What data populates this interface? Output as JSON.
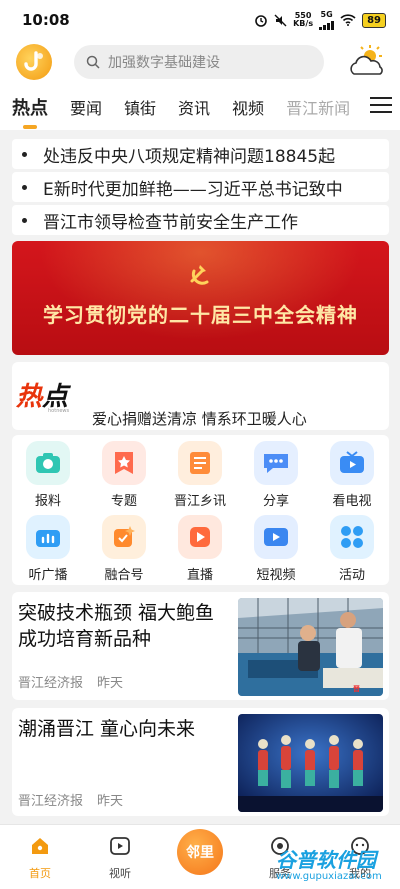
{
  "status_bar": {
    "time": "10:08",
    "net_speed_value": "550",
    "net_speed_unit": "KB/s",
    "signal": "5G",
    "battery": "89"
  },
  "header": {
    "search_placeholder": "加强数字基础建设",
    "logo_icon": "app-logo-icon",
    "weather_icon": "sun-cloud-icon"
  },
  "tabs": [
    {
      "label": "热点",
      "active": true
    },
    {
      "label": "要闻"
    },
    {
      "label": "镇街"
    },
    {
      "label": "资讯"
    },
    {
      "label": "视频"
    },
    {
      "label": "晋江新闻"
    }
  ],
  "ticker": [
    "处违反中央八项规定精神问题18845起",
    "E新时代更加鲜艳——习近平总书记致中",
    "晋江市领导检查节前安全生产工作"
  ],
  "banner": {
    "title": "学习贯彻党的二十届三中全会精神"
  },
  "hot_news": {
    "logo_main": "热",
    "logo_accent": "点",
    "logo_sub": "hotnews",
    "headline": "爱心捐赠送清凉 情系环卫暖人心"
  },
  "grid": [
    {
      "label": "报料",
      "icon": "camera-icon",
      "color": "#2fc6b3",
      "bg": "#e2f7f4"
    },
    {
      "label": "专题",
      "icon": "star-badge-icon",
      "color": "#ff6a4d",
      "bg": "#ffe9e3"
    },
    {
      "label": "晋江乡讯",
      "icon": "news-icon",
      "color": "#ff8c3a",
      "bg": "#ffeedd"
    },
    {
      "label": "分享",
      "icon": "chat-icon",
      "color": "#4c8df6",
      "bg": "#e5efff"
    },
    {
      "label": "看电视",
      "icon": "tv-icon",
      "color": "#3a8cf4",
      "bg": "#e3efff"
    },
    {
      "label": "听广播",
      "icon": "radio-icon",
      "color": "#2f9df4",
      "bg": "#e0f2ff"
    },
    {
      "label": "融合号",
      "icon": "sparkle-icon",
      "color": "#ff8a2d",
      "bg": "#ffefdc"
    },
    {
      "label": "直播",
      "icon": "live-icon",
      "color": "#ff6a3d",
      "bg": "#ffe8de"
    },
    {
      "label": "短视频",
      "icon": "video-icon",
      "color": "#3a86f0",
      "bg": "#e3eeff"
    },
    {
      "label": "活动",
      "icon": "activity-icon",
      "color": "#2f9df4",
      "bg": "#e0f2ff"
    }
  ],
  "articles": [
    {
      "title": "突破技术瓶颈 福大鲍鱼成功培育新品种",
      "source": "晋江经济报",
      "time": "昨天"
    },
    {
      "title": "潮涌晋江 童心向未来",
      "source": "晋江经济报",
      "time": "昨天"
    }
  ],
  "bottom_nav": [
    {
      "label": "首页",
      "icon": "home-icon",
      "active": true
    },
    {
      "label": "视听",
      "icon": "play-icon"
    },
    {
      "label": "邻里",
      "icon": "neighbor-icon"
    },
    {
      "label": "服务",
      "icon": "service-icon"
    },
    {
      "label": "我的",
      "icon": "profile-icon"
    }
  ],
  "watermark": {
    "title": "谷普软件园",
    "url": "www.gupuxiazai.com"
  }
}
